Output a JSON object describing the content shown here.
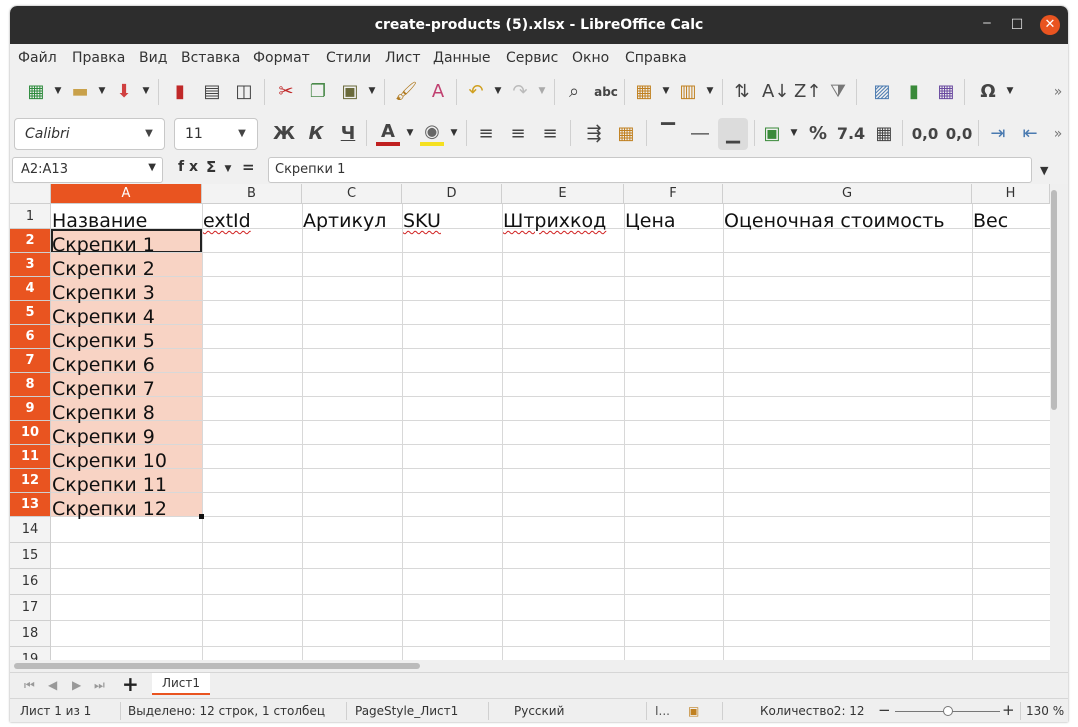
{
  "window": {
    "title": "create-products (5).xlsx - LibreOffice Calc",
    "minimize": "‒",
    "maximize": "☐",
    "close": "✕"
  },
  "menu": [
    "Файл",
    "Правка",
    "Вид",
    "Вставка",
    "Формат",
    "Стили",
    "Лист",
    "Данные",
    "Сервис",
    "Окно",
    "Справка"
  ],
  "toolbar2": {
    "font_name": "Calibri",
    "font_size": "11",
    "bold": "Ж",
    "italic": "К",
    "underline": "Ч",
    "percent": "%",
    "number": "7.4",
    "add_decimal": "0,0",
    "del_decimal": "0,0"
  },
  "formula": {
    "name_box": "A2:A13",
    "fx": "f x",
    "sigma": "Σ",
    "equals": "=",
    "content": "Скрепки 1"
  },
  "columns": [
    "A",
    "B",
    "C",
    "D",
    "E",
    "F",
    "G",
    "H"
  ],
  "rows": [
    "1",
    "2",
    "3",
    "4",
    "5",
    "6",
    "7",
    "8",
    "9",
    "10",
    "11",
    "12",
    "13",
    "14",
    "15",
    "16",
    "17",
    "18",
    "19"
  ],
  "headers": [
    "Название",
    "extId",
    "Артикул",
    "SKU",
    "Штрихкод",
    "Цена",
    "Оценочная стоимость",
    "Вес"
  ],
  "names": [
    "Скрепки 1",
    "Скрепки 2",
    "Скрепки 3",
    "Скрепки 4",
    "Скрепки 5",
    "Скрепки 6",
    "Скрепки 7",
    "Скрепки 8",
    "Скрепки 9",
    "Скрепки 10",
    "Скрепки 11",
    "Скрепки 12"
  ],
  "sheet": {
    "tab": "Лист1",
    "add": "+"
  },
  "status": {
    "sheet_pos": "Лист 1 из 1",
    "selection": "Выделено: 12 строк, 1 столбец",
    "page_style": "PageStyle_Лист1",
    "language": "Русский",
    "count": "Количество2: 12",
    "zoom_minus": "−",
    "zoom_plus": "+",
    "zoom": "130 %"
  },
  "colors": {
    "accent": "#e95420",
    "selection_fill": "#f8d3c4",
    "titlebar": "#2d2d2d"
  }
}
